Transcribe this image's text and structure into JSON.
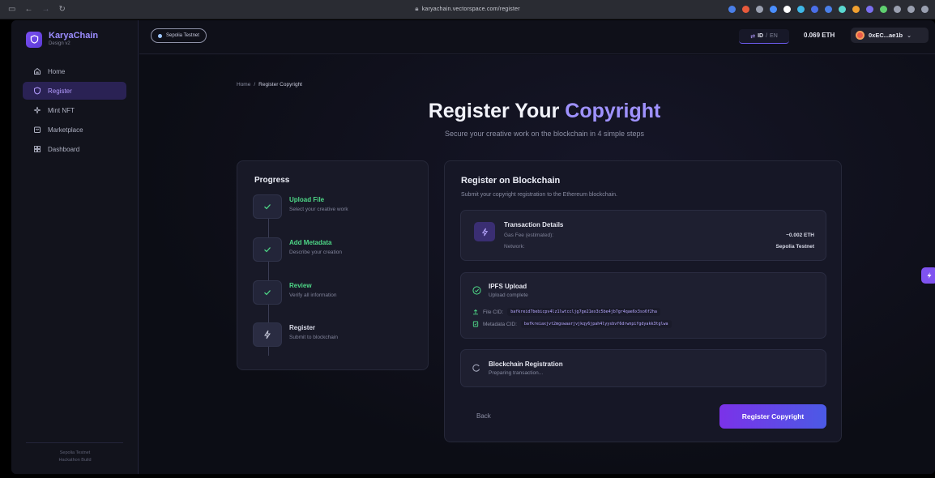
{
  "browser": {
    "url": "karyachain.vectorspace.com/register",
    "extension_colors": [
      "#4a7fe8",
      "#e85a3c",
      "#9aa0b0",
      "#4a8fff",
      "#ffffff",
      "#3fb8e8",
      "#4a6fe8",
      "#4a7fe8",
      "#5ad8d0",
      "#f0a030",
      "#7a6ff0",
      "#5fd070",
      "#9aa0b0",
      "#9aa0b0",
      "#9aa0b0"
    ]
  },
  "sidebar": {
    "brand_name": "KaryaChain",
    "brand_sub": "Design v2",
    "items": [
      {
        "label": "Home",
        "icon": "home-icon",
        "active": false
      },
      {
        "label": "Register",
        "icon": "shield-icon",
        "active": true
      },
      {
        "label": "Mint NFT",
        "icon": "sparkle-icon",
        "active": false
      },
      {
        "label": "Marketplace",
        "icon": "store-icon",
        "active": false
      },
      {
        "label": "Dashboard",
        "icon": "grid-icon",
        "active": false
      }
    ],
    "footer_line1": "Sepolia Testnet",
    "footer_line2": "Hackathon Build"
  },
  "topbar": {
    "network": "Sepolia Testnet",
    "lang_active": "ID",
    "lang_sep": "/",
    "lang_other": "EN",
    "balance": "0.069 ETH",
    "wallet": "0xEC...ae1b"
  },
  "breadcrumb": {
    "home": "Home",
    "separator": "/",
    "current": "Register Copyright"
  },
  "hero": {
    "title_main": "Register Your ",
    "title_accent": "Copyright",
    "subtitle": "Secure your creative work on the blockchain in 4 simple steps"
  },
  "progress": {
    "title": "Progress",
    "steps": [
      {
        "title": "Upload File",
        "desc": "Select your creative work",
        "status": "done"
      },
      {
        "title": "Add Metadata",
        "desc": "Describe your creation",
        "status": "done"
      },
      {
        "title": "Review",
        "desc": "Verify all information",
        "status": "done"
      },
      {
        "title": "Register",
        "desc": "Submit to blockchain",
        "status": "current"
      }
    ]
  },
  "register": {
    "title": "Register on Blockchain",
    "subtitle": "Submit your copyright registration to the Ethereum blockchain.",
    "tx": {
      "title": "Transaction Details",
      "gas_label": "Gas Fee (estimated):",
      "gas_value": "~0.002 ETH",
      "network_label": "Network:",
      "network_value": "Sepolia Testnet"
    },
    "ipfs": {
      "title": "IPFS Upload",
      "status": "Upload complete",
      "file_label": "File CID:",
      "file_cid": "bafkreid7bebicpv4lz1lwtccljg7ge21ex3c5be4jb7gr4qae6x3so6f2ha",
      "meta_label": "Metadata CID:",
      "meta_cid": "bafkreiaxjvt2mgswaarjvjkqy6jpah4lyysbvf6drwnpifgdyakk3tglwa"
    },
    "chain": {
      "title": "Blockchain Registration",
      "status": "Preparing transaction..."
    },
    "back_label": "Back",
    "submit_label": "Register Copyright"
  },
  "colors": {
    "accent": "#9f92ff",
    "success": "#4ed887",
    "primary_button_start": "#7b32e8",
    "primary_button_end": "#4b5ae6"
  }
}
